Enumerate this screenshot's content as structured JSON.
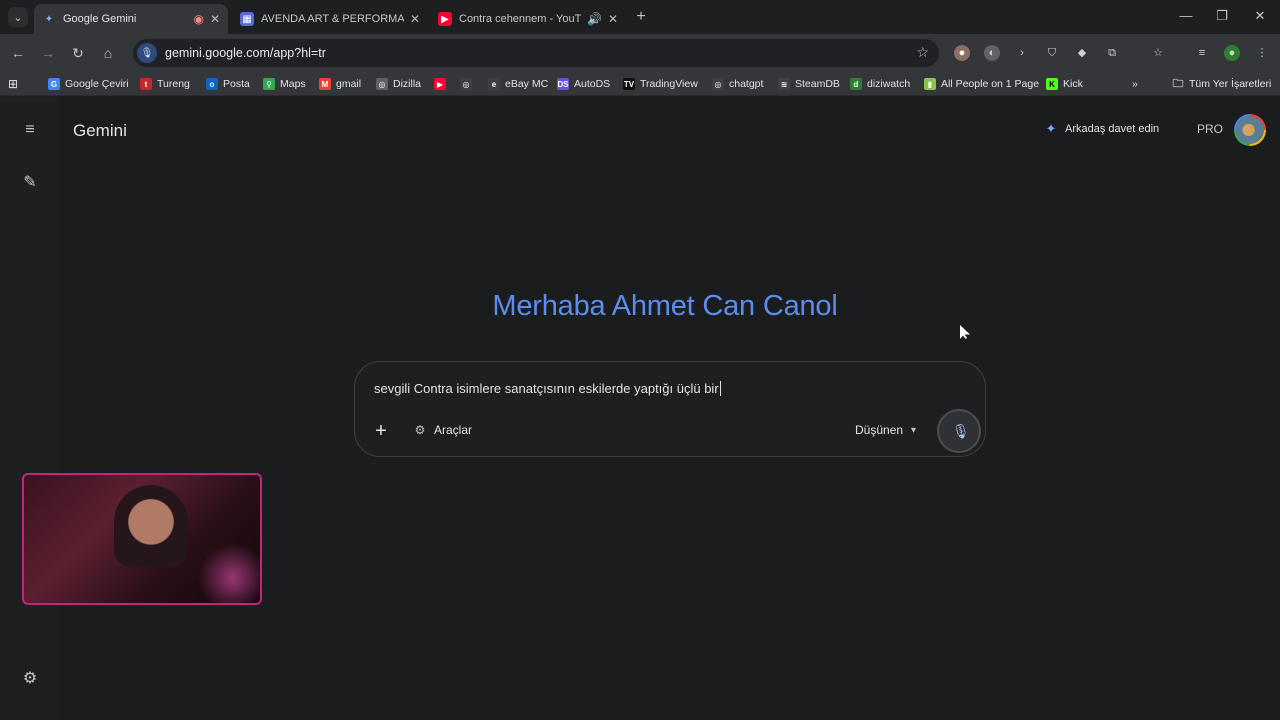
{
  "browser": {
    "tabs": [
      {
        "title": "Google Gemini",
        "active": true
      },
      {
        "title": "AVENDA ART & PERFORMANCE",
        "active": false
      },
      {
        "title": "Contra cehennem - YouTube",
        "active": false
      }
    ],
    "url": "gemini.google.com/app?hl=tr",
    "bookmarks": [
      "Google Çeviri",
      "Tureng",
      "Posta",
      "Maps",
      "gmail",
      "Dizilla",
      "",
      "",
      "eBay MC",
      "AutoDS",
      "TradingView",
      "chatgpt",
      "SteamDB",
      "diziwatch",
      "All People on 1 Page",
      "Kick"
    ],
    "bookmarks_folder": "Tüm Yer İşaretleri"
  },
  "app": {
    "brand": "Gemini",
    "invite_label": "Arkadaş davet edin",
    "plan_badge": "PRO",
    "greeting": "Merhaba Ahmet Can Canol",
    "composer": {
      "prompt_text": "sevgili Contra isimlere sanatçısının eskilerde yaptığı üçlü bir",
      "tools_label": "Araçlar",
      "mode_label": "Düşünen"
    }
  }
}
